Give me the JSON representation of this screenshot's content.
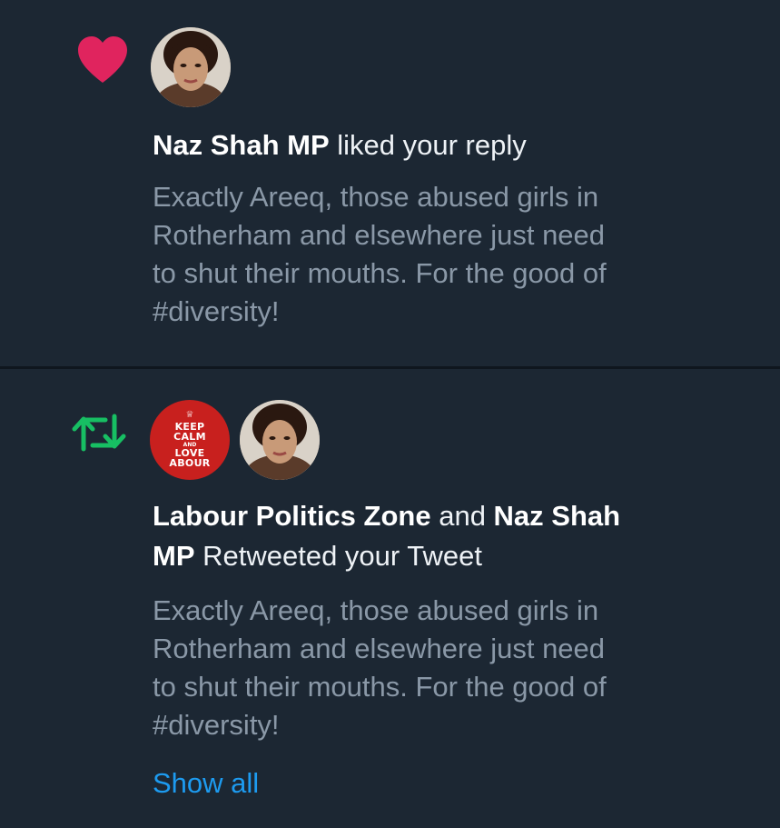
{
  "colors": {
    "background": "#1c2733",
    "heart": "#e0245e",
    "retweet": "#17bf63",
    "link": "#1d9bf0",
    "secondary_text": "#8a98a7"
  },
  "like_notification": {
    "icon": "heart-icon",
    "user_name": "Naz Shah MP",
    "action": " liked your reply",
    "tweet_lines": [
      "Exactly Areeq, those abused girls in",
      "Rotherham and elsewhere just need",
      "to shut their mouths. For the good of",
      "#diversity!"
    ]
  },
  "retweet_notification": {
    "icon": "retweet-icon",
    "avatar_text": {
      "line1": "KEEP",
      "line2": "CALM",
      "line3": "AND",
      "line4": "LOVE",
      "line5": "ABOUR"
    },
    "user_1": "Labour Politics Zone",
    "conjunction": " and ",
    "user_2_part1": "Naz Shah",
    "user_2_part2": "MP",
    "action": " Retweeted your Tweet",
    "tweet_lines": [
      "Exactly Areeq, those abused girls in",
      "Rotherham and elsewhere just need",
      "to shut their mouths. For the good of",
      "#diversity!"
    ],
    "show_all_label": "Show all"
  }
}
